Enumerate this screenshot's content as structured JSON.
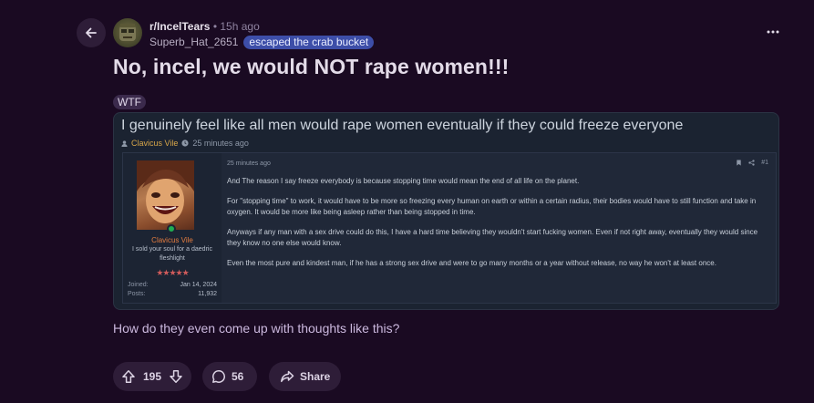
{
  "header": {
    "subreddit": "r/IncelTears",
    "separator": "•",
    "time": "15h ago",
    "username": "Superb_Hat_2651",
    "flair": "escaped the crab bucket"
  },
  "post": {
    "title": "No, incel, we would NOT rape women!!!",
    "tag": "WTF",
    "body": "How do they even come up with thoughts like this?"
  },
  "embed": {
    "title": "I genuinely feel like all men would rape women eventually if they could freeze everyone",
    "author": "Clavicus Vile",
    "time": "25 minutes ago",
    "message": {
      "date": "25 minutes ago",
      "post_number": "#1",
      "username": "Clavicus Vile",
      "user_title": "I sold your soul for a daedric fleshlight",
      "stars": "★★★★★",
      "joined_label": "Joined:",
      "joined_value": "Jan 14, 2024",
      "posts_label": "Posts:",
      "posts_value": "11,932",
      "paragraphs": [
        "And The reason I say freeze everybody is because stopping time would mean the end of all life on the planet.",
        "For \"stopping time\" to work, it would have to be more so freezing every human on earth or within a certain radius, their bodies would have to still function and take in oxygen. It would be more like being asleep rather than being stopped in time.",
        "Anyways if any man with a sex drive could do this, I have a hard time believing they wouldn't start fucking women. Even if not right away, eventually they would since they know no one else would know.",
        "Even the most pure and kindest man, if he has a strong sex drive and were to go many months or a year without release, no way he won't at least once."
      ]
    }
  },
  "actions": {
    "votes": "195",
    "comments": "56",
    "share": "Share"
  },
  "icons": {
    "back": "arrow-left-icon",
    "more": "more-horizontal-icon",
    "upvote": "upvote-icon",
    "downvote": "downvote-icon",
    "comment": "comment-icon",
    "share": "share-icon"
  },
  "colors": {
    "background": "#1a0a22",
    "flair": "#3d4ea8",
    "pill": "#2e1d38",
    "body_text": "#cbb8de",
    "embed_author": "#d7a64a",
    "msg_username": "#e37c3f",
    "online": "#1fae52"
  }
}
